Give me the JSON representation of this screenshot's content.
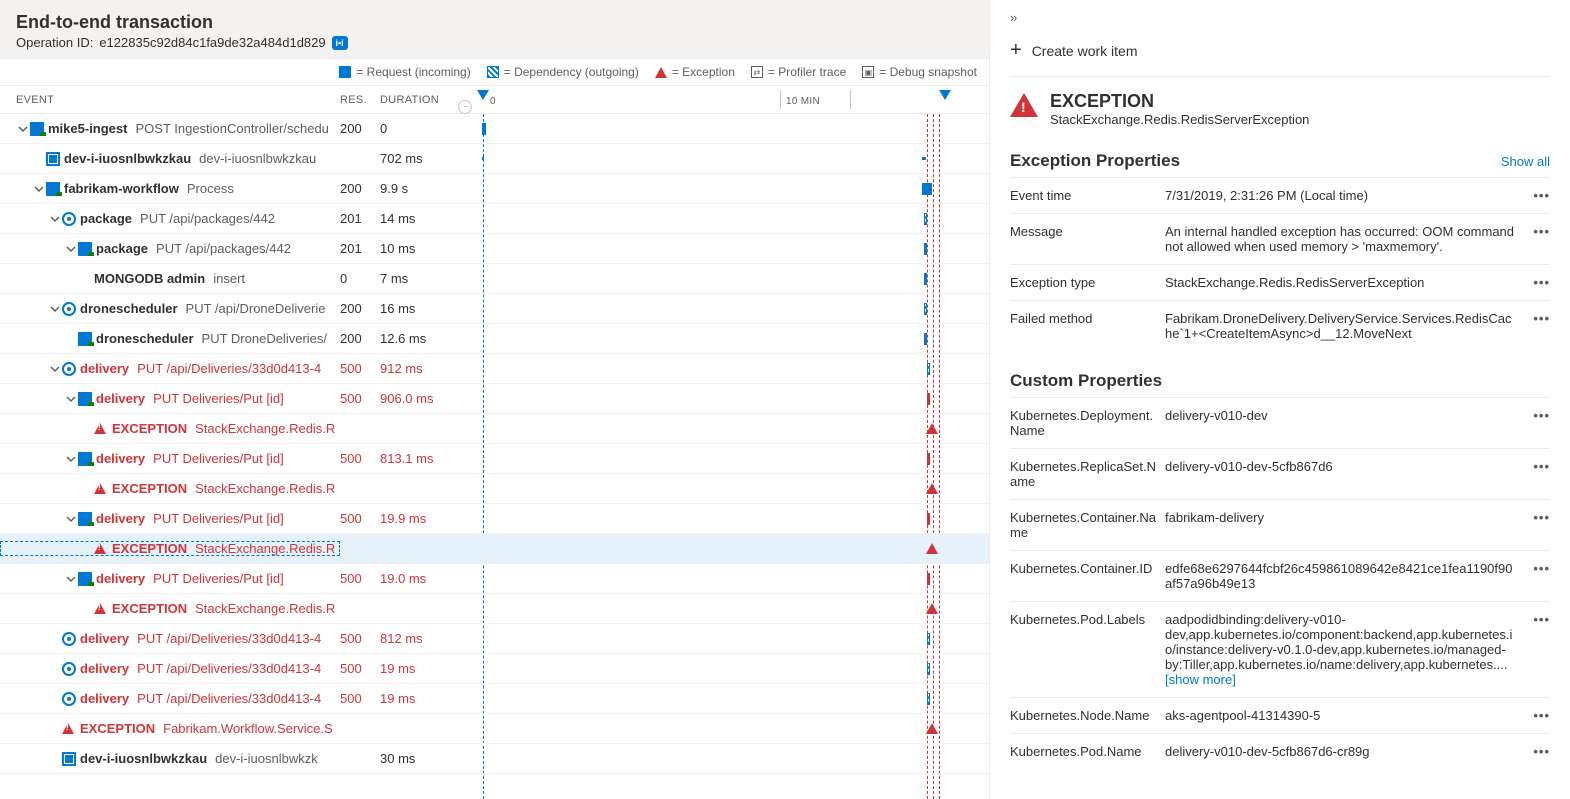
{
  "header": {
    "title": "End-to-end transaction",
    "operation_label": "Operation ID:",
    "operation_id": "e122835c92d84c1fa9de32a484d1d829"
  },
  "legend": {
    "request": "= Request (incoming)",
    "dependency": "= Dependency (outgoing)",
    "exception": "= Exception",
    "profiler": "= Profiler trace",
    "debug": "= Debug snapshot"
  },
  "columns": {
    "event": "EVENT",
    "res": "RES.",
    "duration": "DURATION",
    "tick0": "0",
    "tick10": "10 MIN"
  },
  "rows": [
    {
      "indent": 0,
      "caret": true,
      "icon": "app",
      "name": "mike5-ingest",
      "sub": "POST IngestionController/schedu",
      "res": "200",
      "dur": "0",
      "err": false
    },
    {
      "indent": 1,
      "caret": false,
      "icon": "mail",
      "name": "dev-i-iuosnlbwkzkau",
      "sub": "dev-i-iuosnlbwkzkau",
      "res": "",
      "dur": "702 ms",
      "err": false
    },
    {
      "indent": 1,
      "caret": true,
      "icon": "app",
      "name": "fabrikam-workflow",
      "sub": "Process",
      "res": "200",
      "dur": "9.9 s",
      "err": false
    },
    {
      "indent": 2,
      "caret": true,
      "icon": "dep",
      "name": "package",
      "sub": "PUT /api/packages/442",
      "res": "201",
      "dur": "14 ms",
      "err": false
    },
    {
      "indent": 3,
      "caret": true,
      "icon": "app",
      "name": "package",
      "sub": "PUT /api/packages/442",
      "res": "201",
      "dur": "10 ms",
      "err": false
    },
    {
      "indent": 4,
      "caret": false,
      "icon": "",
      "name": "MONGODB admin",
      "sub": "insert",
      "res": "0",
      "dur": "7 ms",
      "err": false
    },
    {
      "indent": 2,
      "caret": true,
      "icon": "dep",
      "name": "dronescheduler",
      "sub": "PUT /api/DroneDeliverie",
      "res": "200",
      "dur": "16 ms",
      "err": false
    },
    {
      "indent": 3,
      "caret": false,
      "icon": "app",
      "name": "dronescheduler",
      "sub": "PUT DroneDeliveries/",
      "res": "200",
      "dur": "12.6 ms",
      "err": false
    },
    {
      "indent": 2,
      "caret": true,
      "icon": "dep",
      "name": "delivery",
      "sub": "PUT /api/Deliveries/33d0d413-4",
      "res": "500",
      "dur": "912 ms",
      "err": true
    },
    {
      "indent": 3,
      "caret": true,
      "icon": "app",
      "name": "delivery",
      "sub": "PUT Deliveries/Put [id]",
      "res": "500",
      "dur": "906.0 ms",
      "err": true
    },
    {
      "indent": 4,
      "caret": false,
      "icon": "tri",
      "name": "EXCEPTION",
      "sub": "StackExchange.Redis.R",
      "res": "",
      "dur": "",
      "err": true,
      "exc": true
    },
    {
      "indent": 3,
      "caret": true,
      "icon": "app",
      "name": "delivery",
      "sub": "PUT Deliveries/Put [id]",
      "res": "500",
      "dur": "813.1 ms",
      "err": true
    },
    {
      "indent": 4,
      "caret": false,
      "icon": "tri",
      "name": "EXCEPTION",
      "sub": "StackExchange.Redis.R",
      "res": "",
      "dur": "",
      "err": true,
      "exc": true
    },
    {
      "indent": 3,
      "caret": true,
      "icon": "app",
      "name": "delivery",
      "sub": "PUT Deliveries/Put [id]",
      "res": "500",
      "dur": "19.9 ms",
      "err": true
    },
    {
      "indent": 4,
      "caret": false,
      "icon": "tri",
      "name": "EXCEPTION",
      "sub": "StackExchange.Redis.R",
      "res": "",
      "dur": "",
      "err": true,
      "exc": true,
      "selected": true
    },
    {
      "indent": 3,
      "caret": true,
      "icon": "app",
      "name": "delivery",
      "sub": "PUT Deliveries/Put [id]",
      "res": "500",
      "dur": "19.0 ms",
      "err": true
    },
    {
      "indent": 4,
      "caret": false,
      "icon": "tri",
      "name": "EXCEPTION",
      "sub": "StackExchange.Redis.R",
      "res": "",
      "dur": "",
      "err": true,
      "exc": true
    },
    {
      "indent": 2,
      "caret": false,
      "icon": "dep",
      "name": "delivery",
      "sub": "PUT /api/Deliveries/33d0d413-4",
      "res": "500",
      "dur": "812 ms",
      "err": true
    },
    {
      "indent": 2,
      "caret": false,
      "icon": "dep",
      "name": "delivery",
      "sub": "PUT /api/Deliveries/33d0d413-4",
      "res": "500",
      "dur": "19 ms",
      "err": true
    },
    {
      "indent": 2,
      "caret": false,
      "icon": "dep",
      "name": "delivery",
      "sub": "PUT /api/Deliveries/33d0d413-4",
      "res": "500",
      "dur": "19 ms",
      "err": true
    },
    {
      "indent": 2,
      "caret": false,
      "icon": "tri",
      "name": "EXCEPTION",
      "sub": "Fabrikam.Workflow.Service.S",
      "res": "",
      "dur": "",
      "err": true,
      "exc": true
    },
    {
      "indent": 2,
      "caret": false,
      "icon": "mail",
      "name": "dev-i-iuosnlbwkzkau",
      "sub": "dev-i-iuosnlbwkzk",
      "res": "",
      "dur": "30 ms",
      "err": false
    }
  ],
  "right": {
    "create_work_item": "Create work item",
    "exc_heading": "EXCEPTION",
    "exc_type": "StackExchange.Redis.RedisServerException",
    "section1": "Exception Properties",
    "showall": "Show all",
    "props": [
      {
        "k": "Event time",
        "v": "7/31/2019, 2:31:26 PM (Local time)"
      },
      {
        "k": "Message",
        "v": "An internal handled exception has occurred: OOM command not allowed when used memory > 'maxmemory'."
      },
      {
        "k": "Exception type",
        "v": "StackExchange.Redis.RedisServerException"
      },
      {
        "k": "Failed method",
        "v": "Fabrikam.DroneDelivery.DeliveryService.Services.RedisCache`1+<CreateItemAsync>d__12.MoveNext"
      }
    ],
    "section2": "Custom Properties",
    "custom": [
      {
        "k": "Kubernetes.Deployment.Name",
        "v": "delivery-v010-dev"
      },
      {
        "k": "Kubernetes.ReplicaSet.Name",
        "v": "delivery-v010-dev-5cfb867d6"
      },
      {
        "k": "Kubernetes.Container.Name",
        "v": "fabrikam-delivery"
      },
      {
        "k": "Kubernetes.Container.ID",
        "v": "edfe68e6297644fcbf26c459861089642e8421ce1fea1190f90af57a96b49e13"
      },
      {
        "k": "Kubernetes.Pod.Labels",
        "v": "aadpodidbinding:delivery-v010-dev,app.kubernetes.io/component:backend,app.kubernetes.io/instance:delivery-v0.1.0-dev,app.kubernetes.io/managed-by:Tiller,app.kubernetes.io/name:delivery,app.kubernetes....",
        "showmore": true
      },
      {
        "k": "Kubernetes.Node.Name",
        "v": "aks-agentpool-41314390-5"
      },
      {
        "k": "Kubernetes.Pod.Name",
        "v": "delivery-v010-dev-5cfb867d6-cr89g"
      }
    ],
    "showmore_label": "[show more]"
  }
}
